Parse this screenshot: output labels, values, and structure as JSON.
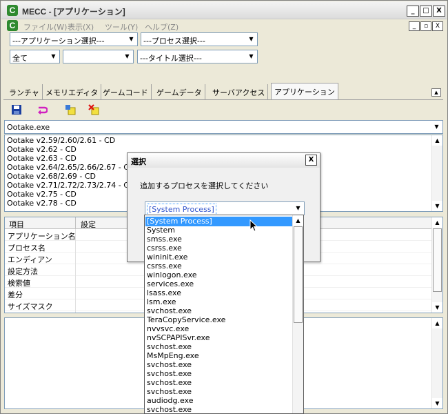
{
  "window": {
    "title": "MECC - [アプリケーション]",
    "icon_letter": "C",
    "caption_buttons": [
      "_",
      "□",
      "X"
    ]
  },
  "menubar": {
    "items": [
      "ファイル(W)",
      "表示(X)",
      "ツール(Y)",
      "ヘルプ(Z)"
    ],
    "mdi_buttons": [
      "_",
      "▫",
      "X"
    ]
  },
  "filters": {
    "application_select": "---アプリケーション選択---",
    "process_select": "---プロセス選択---",
    "scope_select": "全て",
    "blank_select": "",
    "title_select": "---タイトル選択---"
  },
  "tabs": [
    "ランチャ",
    "メモリエディタ",
    "ゲームコード",
    "ゲームデータ",
    "サーバアクセス",
    "アプリケーション"
  ],
  "toolbar": {
    "icons": [
      "save-icon",
      "undo-icon",
      "add-icon",
      "delete-icon"
    ]
  },
  "app_combo": {
    "value": "Ootake.exe"
  },
  "version_list": [
    "Ootake v2.59/2.60/2.61 - CD",
    "Ootake v2.62 - CD",
    "Ootake v2.63 - CD",
    "Ootake v2.64/2.65/2.66/2.67 - CD",
    "Ootake v2.68/2.69 - CD",
    "Ootake v2.71/2.72/2.73/2.74 - CD",
    "Ootake v2.75 - CD",
    "Ootake v2.78 - CD"
  ],
  "property_grid": {
    "headers": [
      "項目",
      "設定"
    ],
    "rows": [
      "アプリケーション名",
      "プロセス名",
      "エンディアン",
      "設定方法",
      "検索値",
      "差分",
      "サイズマスク"
    ]
  },
  "dialog": {
    "title": "選択",
    "close_label": "X",
    "prompt": "追加するプロセスを選択してください",
    "combo_value": "[System Process]"
  },
  "process_dropdown": {
    "selected": "[System Process]",
    "items": [
      "[System Process]",
      "System",
      "smss.exe",
      "csrss.exe",
      "wininit.exe",
      "csrss.exe",
      "winlogon.exe",
      "services.exe",
      "lsass.exe",
      "lsm.exe",
      "svchost.exe",
      "TeraCopyService.exe",
      "nvvsvc.exe",
      "nvSCPAPISvr.exe",
      "svchost.exe",
      "MsMpEng.exe",
      "svchost.exe",
      "svchost.exe",
      "svchost.exe",
      "svchost.exe",
      "audiodg.exe",
      "svchost.exe"
    ]
  },
  "colors": {
    "selection": "#3399ff",
    "app_icon": "#2f8a2f",
    "disabled_menu": "#8a8a8a"
  }
}
